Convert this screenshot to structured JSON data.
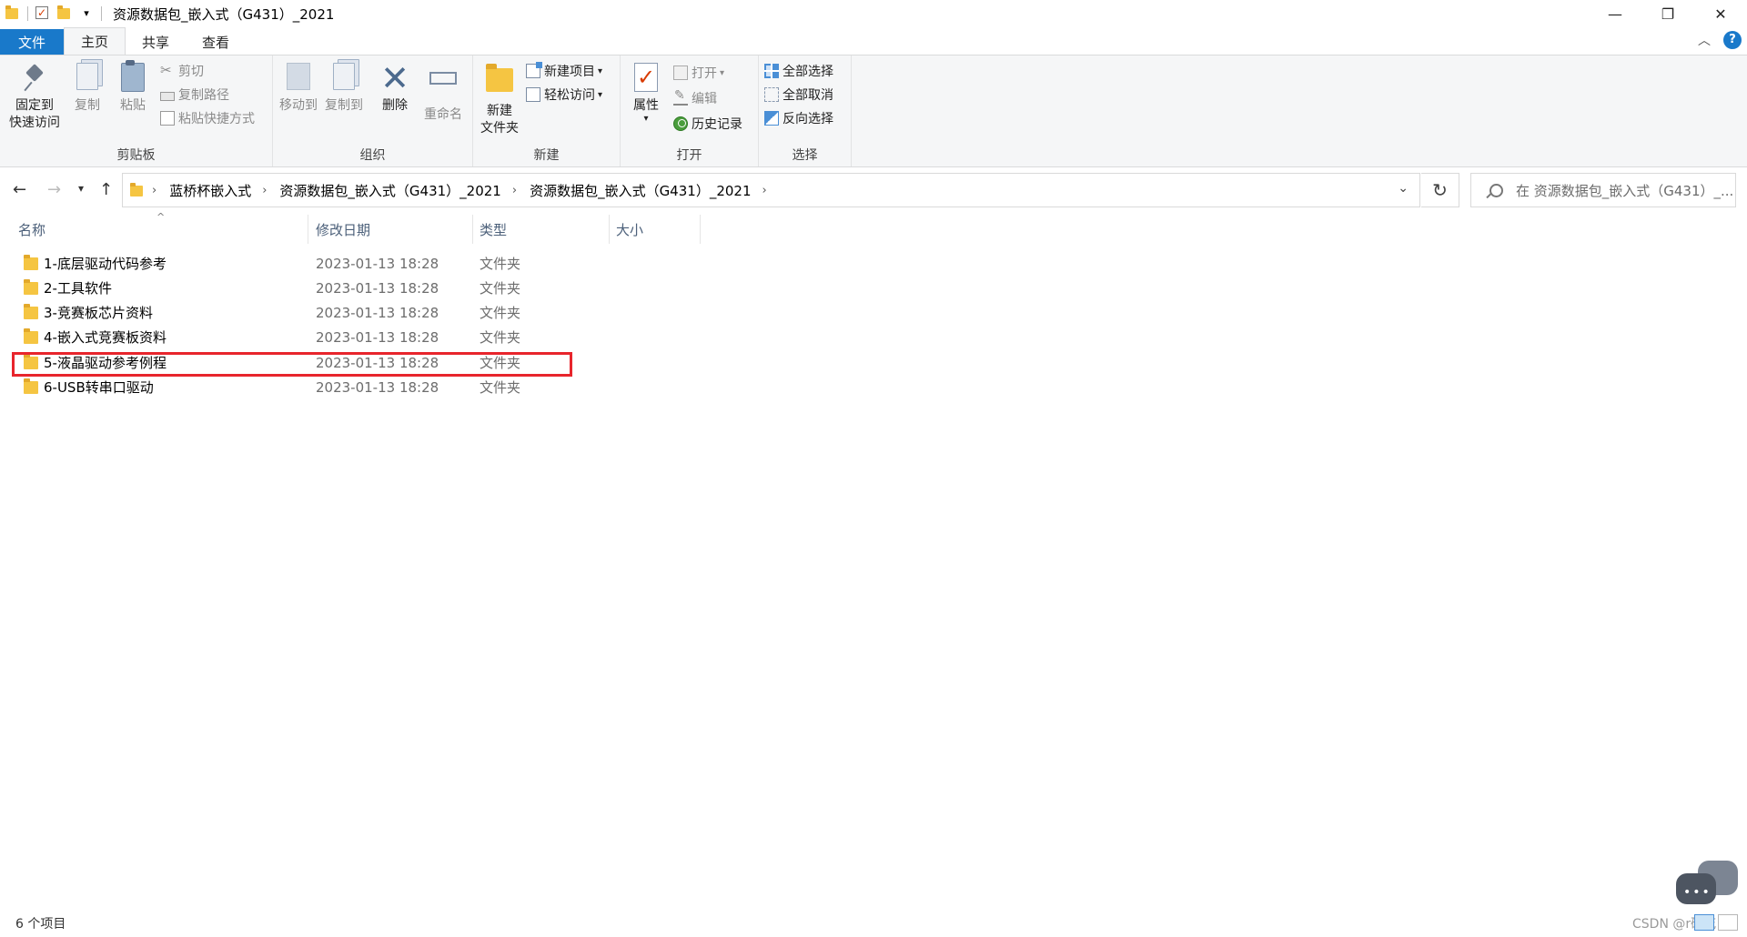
{
  "window": {
    "title": "资源数据包_嵌入式（G431）_2021",
    "minimize": "—",
    "restore": "❐",
    "close": "✕"
  },
  "ribbon_tabs": [
    "文件",
    "主页",
    "共享",
    "查看"
  ],
  "ribbon": {
    "clipboard": {
      "label": "剪贴板",
      "pin_line1": "固定到",
      "pin_line2": "快速访问",
      "copy": "复制",
      "paste": "粘贴",
      "cut": "剪切",
      "copy_path": "复制路径",
      "paste_shortcut": "粘贴快捷方式"
    },
    "organize": {
      "label": "组织",
      "move_to": "移动到",
      "copy_to": "复制到",
      "delete": "删除",
      "rename": "重命名"
    },
    "new": {
      "label": "新建",
      "new_folder_line1": "新建",
      "new_folder_line2": "文件夹",
      "new_item": "新建项目",
      "easy_access": "轻松访问"
    },
    "open": {
      "label": "打开",
      "properties": "属性",
      "open": "打开",
      "edit": "编辑",
      "history": "历史记录"
    },
    "select": {
      "label": "选择",
      "select_all": "全部选择",
      "select_none": "全部取消",
      "invert": "反向选择"
    }
  },
  "address": {
    "crumbs": [
      "蓝桥杯嵌入式",
      "资源数据包_嵌入式（G431）_2021",
      "资源数据包_嵌入式（G431）_2021"
    ],
    "search_placeholder": "在 资源数据包_嵌入式（G431）_..."
  },
  "columns": {
    "name": "名称",
    "modified": "修改日期",
    "type": "类型",
    "size": "大小"
  },
  "files": [
    {
      "name": "1-底层驱动代码参考",
      "modified": "2023-01-13 18:28",
      "type": "文件夹"
    },
    {
      "name": "2-工具软件",
      "modified": "2023-01-13 18:28",
      "type": "文件夹"
    },
    {
      "name": "3-竞赛板芯片资料",
      "modified": "2023-01-13 18:28",
      "type": "文件夹"
    },
    {
      "name": "4-嵌入式竞赛板资料",
      "modified": "2023-01-13 18:28",
      "type": "文件夹"
    },
    {
      "name": "5-液晶驱动参考例程",
      "modified": "2023-01-13 18:28",
      "type": "文件夹"
    },
    {
      "name": "6-USB转串口驱动",
      "modified": "2023-01-13 18:28",
      "type": "文件夹"
    }
  ],
  "status": {
    "item_count": "6 个项目",
    "watermark": "CSDN @r硫花"
  },
  "colors": {
    "file_tab": "#1979ca",
    "highlight": "#e8252c",
    "folder": "#f5c542"
  }
}
